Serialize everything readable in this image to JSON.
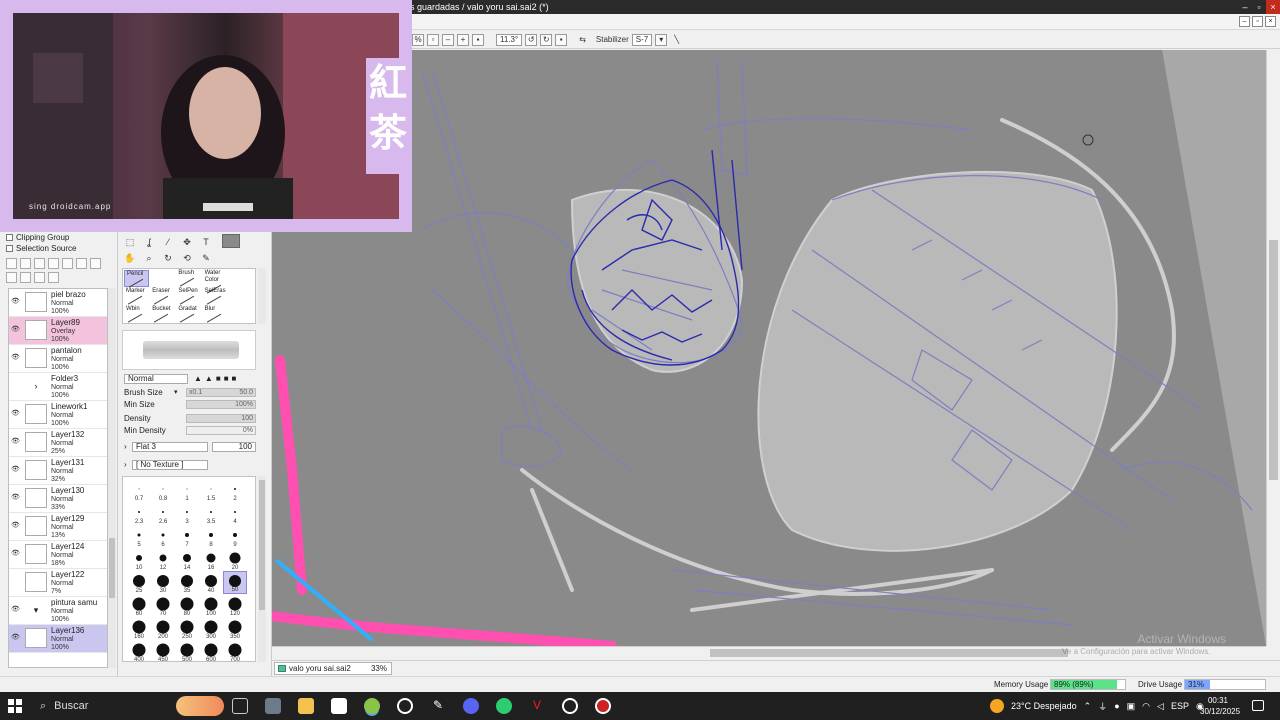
{
  "window": {
    "title": "s guardadas / valo yoru sai.sai2 (*)",
    "controls": [
      "–",
      "▫",
      "×"
    ]
  },
  "toolbar": {
    "zoom_value": "11.3°",
    "stabilizer_label": "Stabilizer",
    "stabilizer_value": "S-7"
  },
  "left_panel": {
    "clipping_group": "Clipping Group",
    "selection_source": "Selection Source",
    "layers": [
      {
        "name": "piel brazo",
        "mode": "Normal",
        "opacity": "100%"
      },
      {
        "name": "Layer89",
        "mode": "Overlay",
        "opacity": "100%"
      },
      {
        "name": "pantalon",
        "mode": "Normal",
        "opacity": "100%"
      },
      {
        "name": "Folder3",
        "mode": "Normal",
        "opacity": "100%"
      },
      {
        "name": "Linework1",
        "mode": "Normal",
        "opacity": "100%"
      },
      {
        "name": "Layer132",
        "mode": "Normal",
        "opacity": "25%"
      },
      {
        "name": "Layer131",
        "mode": "Normal",
        "opacity": "32%"
      },
      {
        "name": "Layer130",
        "mode": "Normal",
        "opacity": "33%"
      },
      {
        "name": "Layer129",
        "mode": "Normal",
        "opacity": "13%"
      },
      {
        "name": "Layer124",
        "mode": "Normal",
        "opacity": "18%"
      },
      {
        "name": "Layer122",
        "mode": "Normal",
        "opacity": "7%"
      },
      {
        "name": "pintura samu",
        "mode": "Normal",
        "opacity": "100%"
      },
      {
        "name": "Layer136",
        "mode": "Normal",
        "opacity": "100%"
      }
    ]
  },
  "tool_panel": {
    "tools": [
      {
        "label": "Pencil",
        "selected": true
      },
      {
        "label": "",
        "selected": false
      },
      {
        "label": "Brush",
        "selected": false
      },
      {
        "label": "Water Color",
        "selected": false
      },
      {
        "label": "",
        "selected": false
      },
      {
        "label": "Marker",
        "selected": false
      },
      {
        "label": "Eraser",
        "selected": false
      },
      {
        "label": "SelPen",
        "selected": false
      },
      {
        "label": "SelEras",
        "selected": false
      },
      {
        "label": "",
        "selected": false
      },
      {
        "label": "Wbin",
        "selected": false
      },
      {
        "label": "Bucket",
        "selected": false
      },
      {
        "label": "Gradat",
        "selected": false
      },
      {
        "label": "Blur",
        "selected": false
      },
      {
        "label": "",
        "selected": false
      }
    ],
    "blend_mode": "Normal",
    "brush_size_label": "Brush Size",
    "brush_size_mult": "x0.1",
    "brush_size_value": "50.0",
    "min_size_label": "Min Size",
    "min_size_value": "100%",
    "density_label": "Density",
    "density_value": "100",
    "min_density_label": "Min Density",
    "min_density_value": "0%",
    "shape_select": "Flat 3",
    "shape_value": "100",
    "texture_select": "[ No Texture ]",
    "sizes": [
      {
        "label": "0.7",
        "dot": 1
      },
      {
        "label": "0.8",
        "dot": 1
      },
      {
        "label": "1",
        "dot": 1
      },
      {
        "label": "1.5",
        "dot": 1
      },
      {
        "label": "2",
        "dot": 2
      },
      {
        "label": "2.3",
        "dot": 2
      },
      {
        "label": "2.6",
        "dot": 2
      },
      {
        "label": "3",
        "dot": 2
      },
      {
        "label": "3.5",
        "dot": 2
      },
      {
        "label": "4",
        "dot": 2
      },
      {
        "label": "5",
        "dot": 3
      },
      {
        "label": "6",
        "dot": 3
      },
      {
        "label": "7",
        "dot": 4
      },
      {
        "label": "8",
        "dot": 4
      },
      {
        "label": "9",
        "dot": 4
      },
      {
        "label": "10",
        "dot": 6
      },
      {
        "label": "12",
        "dot": 7
      },
      {
        "label": "14",
        "dot": 8
      },
      {
        "label": "16",
        "dot": 9
      },
      {
        "label": "20",
        "dot": 11
      },
      {
        "label": "25",
        "dot": 12
      },
      {
        "label": "30",
        "dot": 12
      },
      {
        "label": "35",
        "dot": 12
      },
      {
        "label": "40",
        "dot": 12
      },
      {
        "label": "50",
        "dot": 12
      },
      {
        "label": "60",
        "dot": 13
      },
      {
        "label": "70",
        "dot": 13
      },
      {
        "label": "80",
        "dot": 13
      },
      {
        "label": "100",
        "dot": 13
      },
      {
        "label": "120",
        "dot": 13
      },
      {
        "label": "160",
        "dot": 13
      },
      {
        "label": "200",
        "dot": 13
      },
      {
        "label": "250",
        "dot": 13
      },
      {
        "label": "300",
        "dot": 13
      },
      {
        "label": "350",
        "dot": 13
      },
      {
        "label": "400",
        "dot": 13
      },
      {
        "label": "450",
        "dot": 13
      },
      {
        "label": "500",
        "dot": 13
      },
      {
        "label": "600",
        "dot": 13
      },
      {
        "label": "700",
        "dot": 13
      }
    ],
    "selected_size": "50"
  },
  "canvas": {
    "watermark_title": "Activar Windows",
    "watermark_sub": "Ve a Configuración para activar Windows."
  },
  "document_tab": {
    "name": "valo yoru sai.sai2",
    "zoom": "33%"
  },
  "status": {
    "memory_label": "Memory Usage",
    "memory_value": "89% (89%)",
    "memory_fraction": 0.89,
    "drive_label": "Drive Usage",
    "drive_value": "31%",
    "drive_fraction": 0.31,
    "memory_color": "#5be38a",
    "drive_color": "#7da7ff"
  },
  "webcam": {
    "overlay_text": "紅茶",
    "watermark": "sing droidcam.app"
  },
  "taskbar": {
    "search_label": "Buscar",
    "weather": "23°C Despejado",
    "language": "ESP",
    "time": "00:31",
    "date": "30/12/2025"
  }
}
